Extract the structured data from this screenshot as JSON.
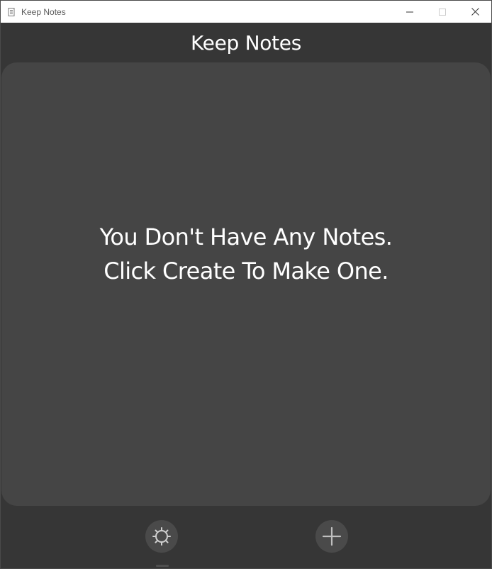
{
  "window": {
    "title": "Keep Notes"
  },
  "header": {
    "title": "Keep Notes"
  },
  "main": {
    "empty_line1": "You Don't Have Any Notes.",
    "empty_line2": "Click Create To Make One."
  },
  "footer": {
    "settings_icon": "gear-icon",
    "add_icon": "plus-icon"
  },
  "colors": {
    "background": "#363636",
    "panel": "#454545",
    "button": "#4a4a4a",
    "text": "#ffffff"
  }
}
